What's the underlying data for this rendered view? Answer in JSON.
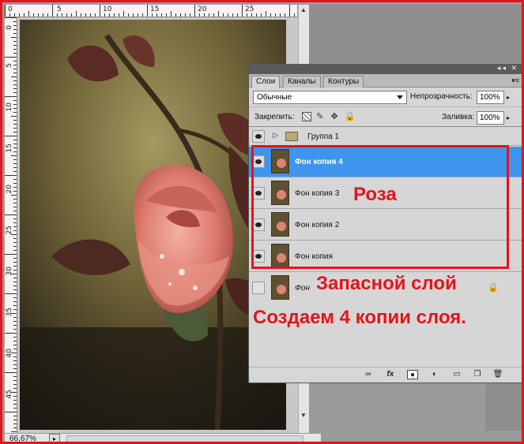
{
  "status": {
    "zoom": "66,67%"
  },
  "ruler": {
    "top_numbers": [
      "0",
      "5",
      "10",
      "15",
      "20",
      "25"
    ],
    "left_numbers": [
      "0",
      "5",
      "10",
      "15",
      "20",
      "25",
      "30",
      "35",
      "40",
      "45"
    ]
  },
  "layers_panel": {
    "tabs": [
      "Слои",
      "Каналы",
      "Контуры"
    ],
    "active_tab": "Слои",
    "blend_mode": "Обычные",
    "opacity_label": "Непрозрачность:",
    "opacity_value": "100%",
    "lock_label": "Закрепить:",
    "fill_label": "Заливка:",
    "fill_value": "100%",
    "group_name": "Группа 1",
    "layers": [
      {
        "name": "Фон копия 4",
        "selected": true,
        "visible": true
      },
      {
        "name": "Фон копия 3",
        "selected": false,
        "visible": true
      },
      {
        "name": "Фон копия 2",
        "selected": false,
        "visible": true
      },
      {
        "name": "Фон копия",
        "selected": false,
        "visible": true
      }
    ],
    "background_layer_name": "Фон"
  },
  "annotations": {
    "roza": "Роза",
    "zapasnoy": "Запасной слой",
    "sozdaem": "Создаем 4 копии слоя."
  },
  "colors": {
    "annotation_red": "#e3141c",
    "selected_layer": "#3d95ee"
  },
  "icons": {
    "lock_icons": [
      "lock-transparent-icon",
      "brush-icon",
      "move-icon",
      "lock-icon"
    ],
    "footer_icons": [
      "link-icon",
      "fx-icon",
      "mask-icon",
      "adjustment-icon",
      "folder-icon",
      "new-layer-icon",
      "trash-icon"
    ]
  }
}
